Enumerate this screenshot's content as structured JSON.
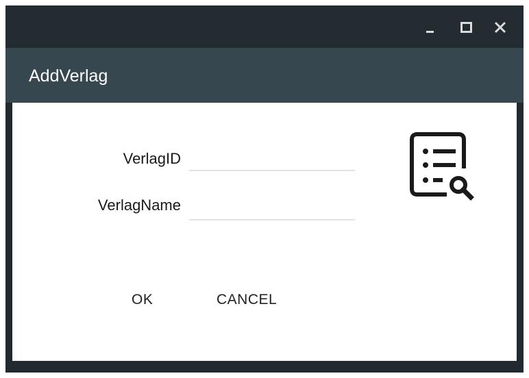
{
  "window": {
    "controls": {
      "minimize_icon": "minimize-icon",
      "maximize_icon": "maximize-icon",
      "close_icon": "close-icon"
    }
  },
  "header": {
    "title": "AddVerlag"
  },
  "form": {
    "fields": [
      {
        "label": "VerlagID",
        "value": "",
        "placeholder": ""
      },
      {
        "label": "VerlagName",
        "value": "",
        "placeholder": ""
      }
    ],
    "buttons": {
      "ok_label": "OK",
      "cancel_label": "CANCEL"
    }
  },
  "icons": {
    "decorative": "list-search-icon"
  },
  "colors": {
    "titlebar": "#222c31",
    "header": "#37474f",
    "content": "#ffffff",
    "text": "#1a1a1a"
  }
}
